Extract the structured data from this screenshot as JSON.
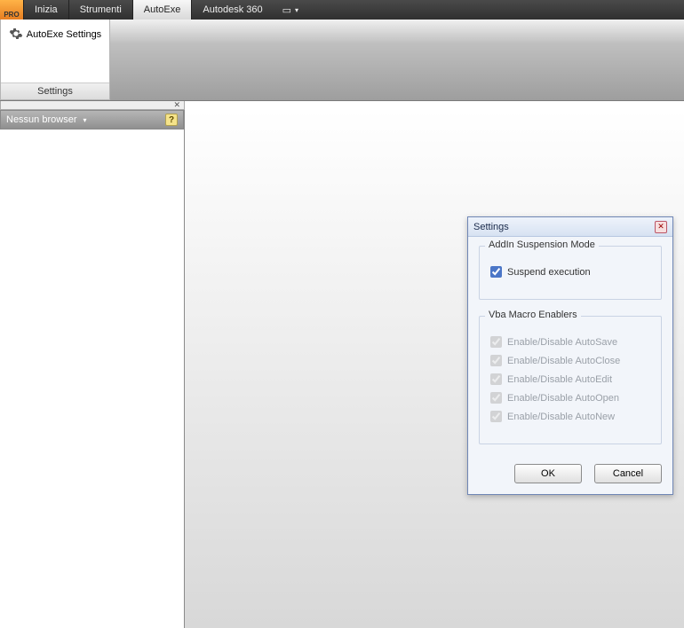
{
  "menubar": {
    "pro": "PRO",
    "items": [
      "Inizia",
      "Strumenti",
      "AutoExe",
      "Autodesk 360"
    ],
    "active_index": 2,
    "extra_glyph": "▭"
  },
  "ribbon": {
    "button_label": "AutoExe Settings",
    "panel_title": "Settings"
  },
  "sidebar": {
    "browser_label": "Nessun browser",
    "help_glyph": "?"
  },
  "dialog": {
    "title": "Settings",
    "group1": {
      "header": "AddIn Suspension Mode",
      "opt1": "Suspend execution"
    },
    "group2": {
      "header": "Vba Macro Enablers",
      "opts": [
        "Enable/Disable AutoSave",
        "Enable/Disable AutoClose",
        "Enable/Disable AutoEdit",
        "Enable/Disable AutoOpen",
        "Enable/Disable AutoNew"
      ]
    },
    "ok": "OK",
    "cancel": "Cancel"
  }
}
